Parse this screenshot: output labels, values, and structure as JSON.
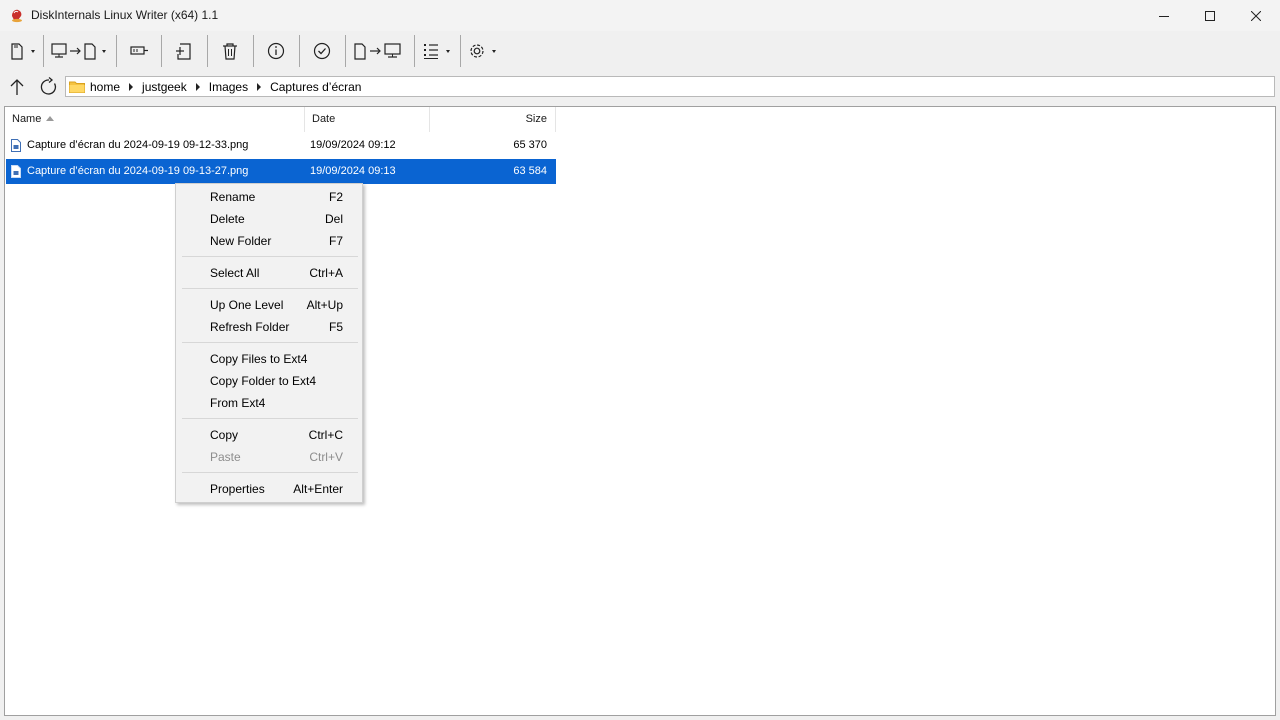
{
  "window": {
    "title": "DiskInternals Linux Writer (x64) 1.1",
    "accent": "#0a64d2"
  },
  "toolbar": {
    "buttons": [
      {
        "name": "drive-dropdown",
        "icon": "sd-card-icon"
      },
      {
        "name": "computer-to-drive",
        "icon": "computer-arrow-drive-icon"
      },
      {
        "name": "mount-image",
        "icon": "mount-icon"
      },
      {
        "name": "new-folder",
        "icon": "new-folder-icon"
      },
      {
        "name": "delete",
        "icon": "trash-icon"
      },
      {
        "name": "properties",
        "icon": "info-icon"
      },
      {
        "name": "check",
        "icon": "check-circle-icon"
      },
      {
        "name": "drive-to-computer",
        "icon": "drive-arrow-computer-icon"
      },
      {
        "name": "view-mode",
        "icon": "list-view-icon"
      },
      {
        "name": "settings",
        "icon": "gear-icon"
      }
    ]
  },
  "navbar": {
    "path": [
      "home",
      "justgeek",
      "Images",
      "Captures d’écran"
    ]
  },
  "columns": {
    "name": "Name",
    "date": "Date",
    "size": "Size"
  },
  "files": [
    {
      "name": "Capture d’écran du 2024-09-19 09-12-33.png",
      "date": "19/09/2024 09:12",
      "size": "65 370",
      "selected": false
    },
    {
      "name": "Capture d’écran du 2024-09-19 09-13-27.png",
      "date": "19/09/2024 09:13",
      "size": "63 584",
      "selected": true
    }
  ],
  "context_menu": {
    "rename": {
      "label": "Rename",
      "shortcut": "F2"
    },
    "delete": {
      "label": "Delete",
      "shortcut": "Del"
    },
    "new_folder": {
      "label": "New Folder",
      "shortcut": "F7"
    },
    "select_all": {
      "label": "Select All",
      "shortcut": "Ctrl+A"
    },
    "up_one_level": {
      "label": "Up One Level",
      "shortcut": "Alt+Up"
    },
    "refresh_folder": {
      "label": "Refresh Folder",
      "shortcut": "F5"
    },
    "copy_files": {
      "label": "Copy Files to Ext4",
      "shortcut": ""
    },
    "copy_folder": {
      "label": "Copy Folder to Ext4",
      "shortcut": ""
    },
    "from_ext4": {
      "label": "From Ext4",
      "shortcut": ""
    },
    "copy": {
      "label": "Copy",
      "shortcut": "Ctrl+C"
    },
    "paste": {
      "label": "Paste",
      "shortcut": "Ctrl+V",
      "disabled": true
    },
    "properties": {
      "label": "Properties",
      "shortcut": "Alt+Enter"
    }
  }
}
